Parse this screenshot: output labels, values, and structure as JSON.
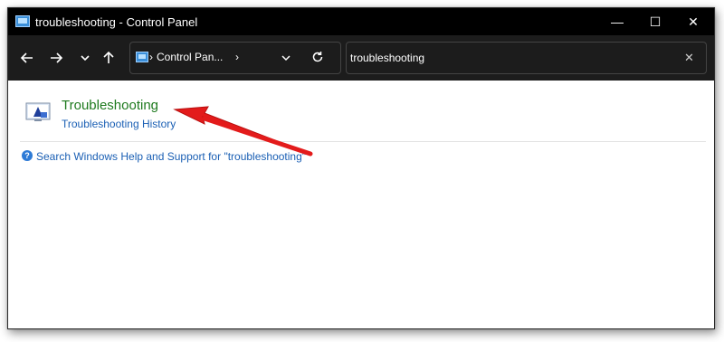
{
  "window": {
    "title": "troubleshooting - Control Panel"
  },
  "titlebar": {
    "minimize": "—",
    "maximize": "☐",
    "close": "✕"
  },
  "toolbar": {
    "back_icon": "←",
    "forward_icon": "→",
    "history_icon": "⌄",
    "up_icon": "↑",
    "address_chevron": "›",
    "address_text": "Control Pan...",
    "address_chevron2": "›"
  },
  "search": {
    "value": "troubleshooting",
    "clear": "✕"
  },
  "results": {
    "title": "Troubleshooting",
    "subtitle": "Troubleshooting History"
  },
  "help": {
    "icon": "?",
    "link": "Search Windows Help and Support for \"troubleshooting\""
  },
  "colors": {
    "title_green": "#1e7a1e",
    "link_blue": "#1a5fb4",
    "arrow_red": "#e31b1b"
  }
}
